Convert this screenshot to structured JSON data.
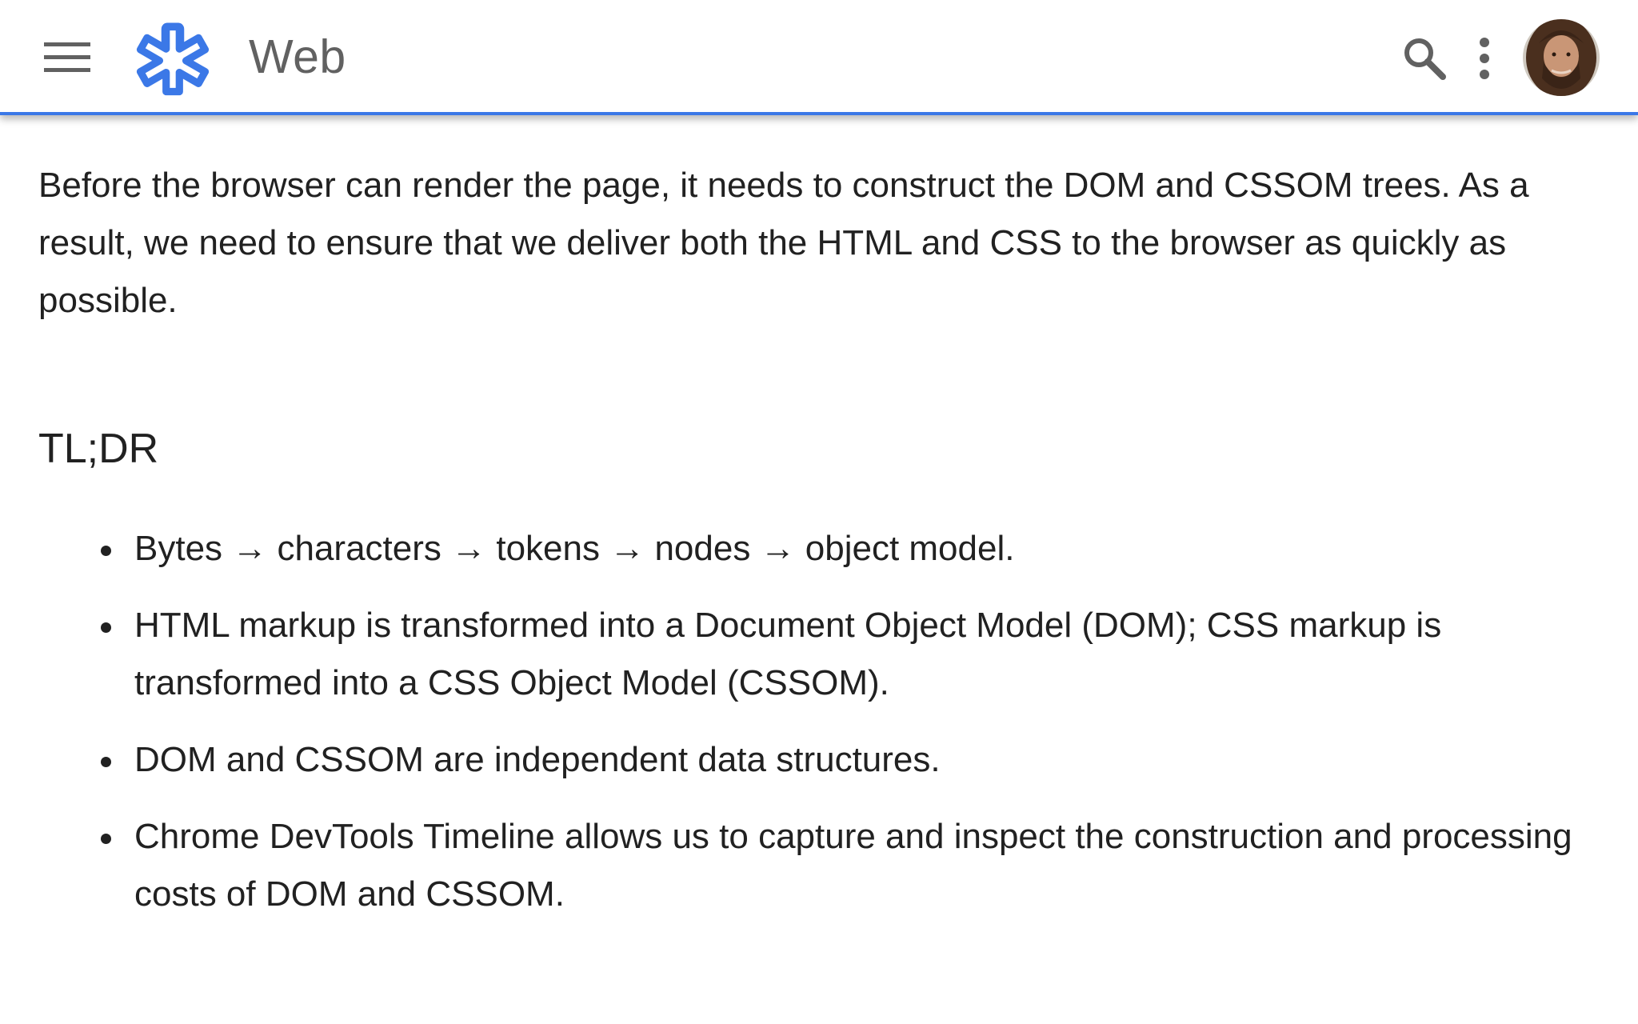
{
  "header": {
    "title": "Web",
    "menu_icon": "hamburger-menu-icon",
    "logo_icon": "web-fundamentals-logo",
    "search_icon": "search-icon",
    "more_icon": "more-vert-icon",
    "accent_color": "#3b78e7"
  },
  "article": {
    "intro": "Before the browser can render the page, it needs to construct the DOM and CSSOM trees. As a result, we need to ensure that we deliver both the HTML and CSS to the browser as quickly as possible.",
    "heading": "TL;DR",
    "bullets": [
      "Bytes → characters → tokens → nodes → object model.",
      "HTML markup is transformed into a Document Object Model (DOM); CSS markup is transformed into a CSS Object Model (CSSOM).",
      "DOM and CSSOM are independent data structures.",
      "Chrome DevTools Timeline allows us to capture and inspect the construction and processing costs of DOM and CSSOM."
    ]
  }
}
